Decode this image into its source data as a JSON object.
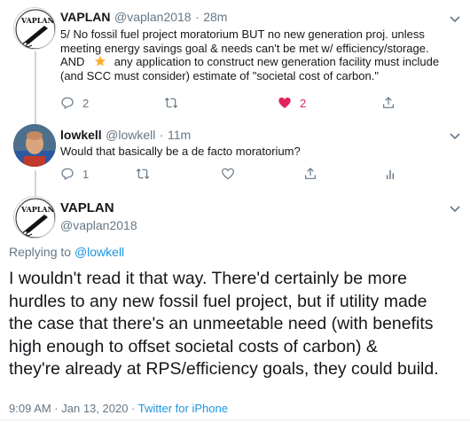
{
  "tweet1": {
    "name": "VAPLAN",
    "handle": "@vaplan2018",
    "separator": "·",
    "time": "28m",
    "text_lines": [
      "5/ No fossil fuel project moratorium BUT no new generation proj. unless",
      "meeting energy savings goal & needs can't be met w/ efficiency/storage.",
      "AND",
      "any application to construct new generation facility must include",
      "(and SCC must consider) estimate of \"societal cost of carbon.\""
    ],
    "emoji": "star",
    "replies": "2",
    "likes": "2"
  },
  "tweet2": {
    "name": "lowkell",
    "handle": "@lowkell",
    "separator": "·",
    "time": "11m",
    "text": "Would that basically be a de facto moratorium?",
    "replies": "1"
  },
  "main": {
    "name": "VAPLAN",
    "handle": "@vaplan2018",
    "replying_prefix": "Replying to",
    "replying_to": "@lowkell",
    "text_lines": [
      "I wouldn't read it that way. There'd certainly be more",
      "hurdles to any new fossil fuel project, but if utility made",
      "the case that there's an unmeetable need (with benefits",
      "high enough to offset societal costs of carbon) &",
      "they're already at RPS/efficiency goals, they could build."
    ],
    "timestamp": "9:09 AM · Jan 13, 2020 ·",
    "source": "Twitter for iPhone"
  },
  "colors": {
    "like": "#e0245e",
    "link": "#1b95e0",
    "secondary": "#657786",
    "divider": "#e6ecf0"
  }
}
